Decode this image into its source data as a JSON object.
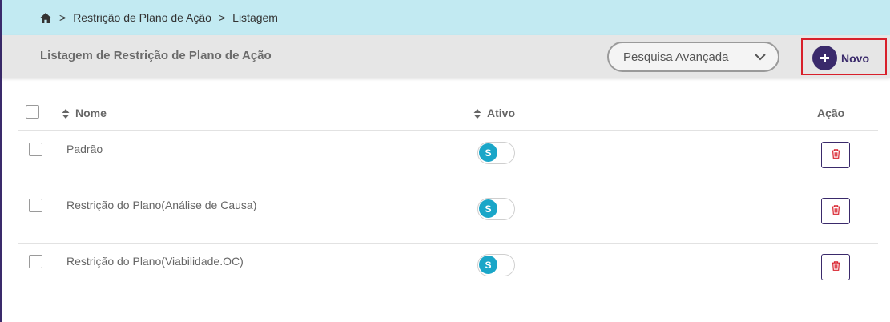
{
  "breadcrumb": {
    "home_icon": "home-icon",
    "separator": ">",
    "items": [
      "Restrição de Plano de Ação",
      "Listagem"
    ]
  },
  "header": {
    "title": "Listagem de Restrição de Plano de Ação",
    "advanced_search_label": "Pesquisa Avançada",
    "new_button_label": "Novo"
  },
  "table": {
    "columns": {
      "nome": "Nome",
      "ativo": "Ativo",
      "acao": "Ação"
    },
    "rows": [
      {
        "nome": "Padrão",
        "ativo": "S"
      },
      {
        "nome": "Restrição do Plano(Análise de Causa)",
        "ativo": "S"
      },
      {
        "nome": "Restrição do Plano(Viabilidade.OC)",
        "ativo": "S"
      }
    ]
  },
  "colors": {
    "breadcrumb_bg": "#c2eaf2",
    "primary": "#3a2a6b",
    "toggle_on": "#1aa6c8",
    "delete_icon": "#d8202b",
    "highlight_border": "#d8202b"
  }
}
